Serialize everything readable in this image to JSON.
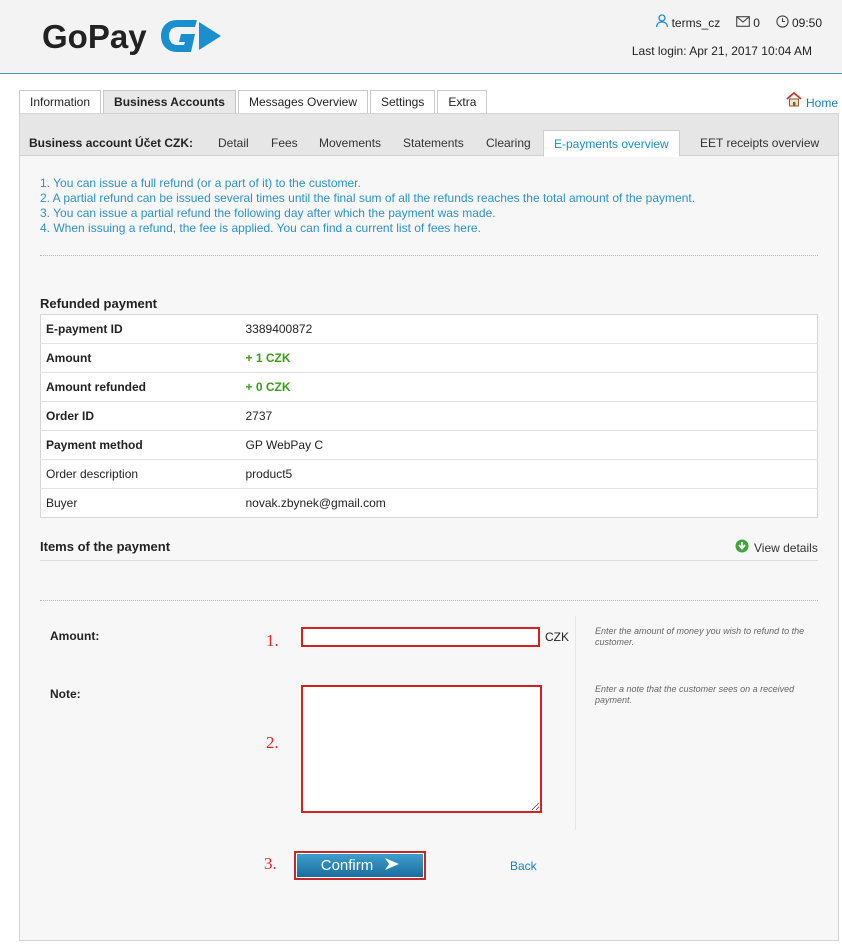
{
  "brand": {
    "name": "GoPay",
    "accent": "#1a8fd0"
  },
  "header": {
    "username": "terms_cz",
    "messages_count": "0",
    "time": "09:50",
    "last_login": "Last login: Apr 21, 2017 10:04 AM"
  },
  "main_tabs": [
    "Information",
    "Business Accounts",
    "Messages Overview",
    "Settings",
    "Extra"
  ],
  "home_label": "Home",
  "sub_nav": {
    "title": "Business account Účet CZK:",
    "tabs": [
      "Detail",
      "Fees",
      "Movements",
      "Statements",
      "Clearing",
      "E-payments overview",
      "EET receipts overview"
    ]
  },
  "notes": [
    "1. You can issue a full refund (or a part of it) to the customer.",
    "2. A partial refund can be issued several times until the final sum of all the refunds reaches the total amount of the payment.",
    "3. You can issue a partial refund the following day after which the payment was made.",
    "4. When issuing a refund, the fee is applied. You can find a current list of fees here."
  ],
  "refunded_payment": {
    "title": "Refunded payment",
    "rows": [
      {
        "label": "E-payment ID",
        "value": "3389400872"
      },
      {
        "label": "Amount",
        "value": "+ 1 CZK"
      },
      {
        "label": "Amount refunded",
        "value": "+ 0 CZK"
      },
      {
        "label": "Order ID",
        "value": "2737"
      },
      {
        "label": "Payment method",
        "value": "GP WebPay C"
      },
      {
        "label": "Order description",
        "value": "product5"
      },
      {
        "label": "Buyer",
        "value": "novak.zbynek@gmail.com"
      }
    ]
  },
  "items": {
    "title": "Items of the payment",
    "view_details": "View details"
  },
  "form": {
    "amount_label": "Amount:",
    "amount_value": "",
    "currency": "CZK",
    "amount_hint": "Enter the amount of money you wish to refund to the customer.",
    "note_label": "Note:",
    "note_value": "",
    "note_hint": "Enter a note that the customer sees on a received payment.",
    "step1": "1.",
    "step2": "2.",
    "step3": "3.",
    "confirm_label": "Confirm",
    "back_label": "Back"
  }
}
